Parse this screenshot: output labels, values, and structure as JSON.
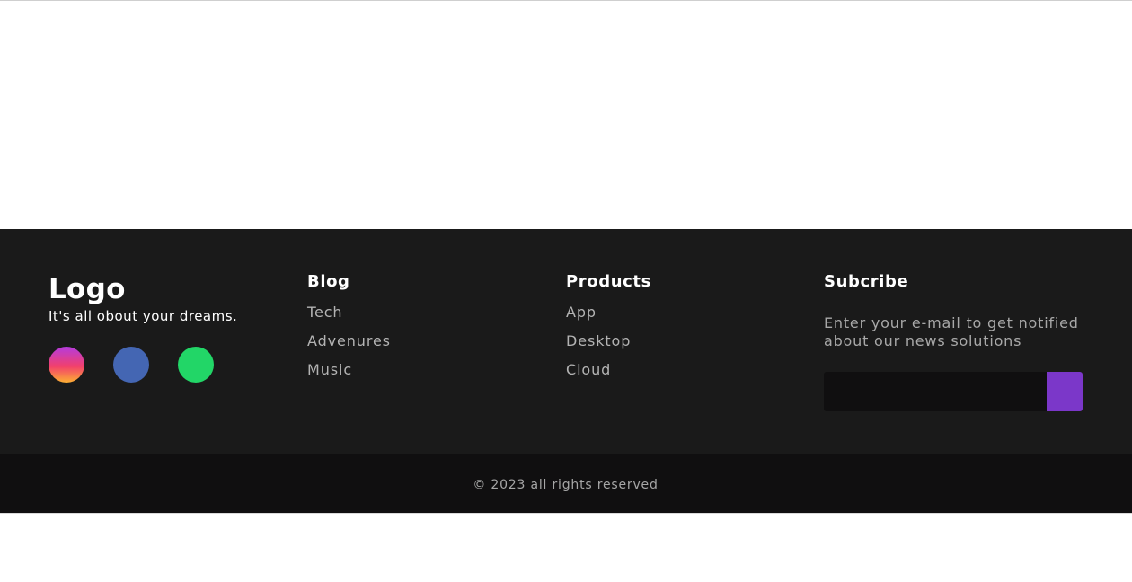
{
  "brand": {
    "logo": "Logo",
    "tagline": "It's all obout your dreams."
  },
  "socials": [
    {
      "icon": "instagram-icon"
    },
    {
      "icon": "facebook-icon"
    },
    {
      "icon": "whatsapp-icon"
    }
  ],
  "blog": {
    "heading": "Blog",
    "links": [
      "Tech",
      "Advenures",
      "Music"
    ]
  },
  "products": {
    "heading": "Products",
    "links": [
      "App",
      "Desktop",
      "Cloud"
    ]
  },
  "subscribe": {
    "heading": "Subcribe",
    "text": "Enter your e-mail to get notified about our news solutions",
    "email_value": "",
    "button_color": "#7b37c9"
  },
  "footer": {
    "copyright": "© 2023 all rights reserved",
    "background": "#1a1a1a",
    "bottom_background": "#100f10"
  }
}
